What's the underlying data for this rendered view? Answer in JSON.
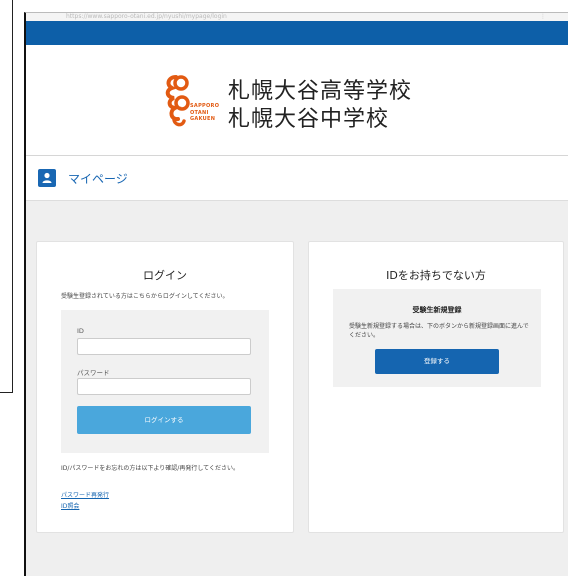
{
  "browser": {
    "address": "https://www.sapporo-otani.ed.jp/nyushi/mypage/login",
    "menu_dots": "⋮"
  },
  "logo": {
    "eng_line1": "SAPPORO",
    "eng_line2": "OTANI",
    "eng_line3": "GAKUEN",
    "school_high": "札幌大谷高等学校",
    "school_junior": "札幌大谷中学校",
    "orange": "#e25a12"
  },
  "header": {
    "mypage_label": "マイページ",
    "accent": "#1967b3",
    "bar_color": "#0d5fa8"
  },
  "login": {
    "title": "ログイン",
    "intro": "受験生登録されている方はこちらからログインしてください。",
    "id_label": "ID",
    "id_value": "",
    "password_label": "パスワード",
    "password_value": "",
    "submit_label": "ログインする",
    "forgot_text": "ID/パスワードをお忘れの方は以下より確認/再発行してください。",
    "link_password_reissue": "パスワード再発行",
    "link_id_lookup": "ID照会"
  },
  "register": {
    "title": "IDをお持ちでない方",
    "box_title": "受験生新規登録",
    "description": "受験生新規登録する場合は、下のボタンから新規登録画面に進んでください。",
    "submit_label": "登録する"
  }
}
